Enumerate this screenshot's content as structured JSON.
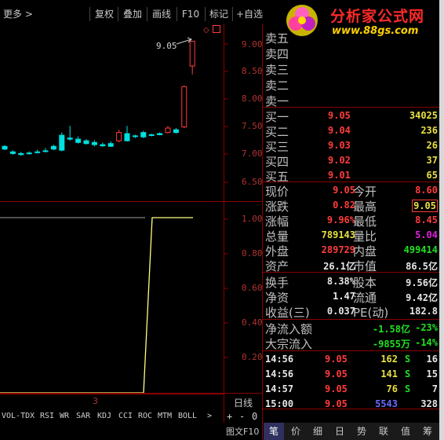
{
  "toolbar": {
    "more": "更多",
    "items": [
      "复权",
      "叠加",
      "画线",
      "F10",
      "标记",
      "+自选"
    ]
  },
  "logo": {
    "main": "分析家公式网",
    "url": "www.88gs.com"
  },
  "kline": {
    "price_labels": [
      "9.00",
      "8.50",
      "8.00",
      "7.50",
      "7.00",
      "6.50"
    ],
    "annotation": "9.05"
  },
  "indicator": {
    "labels": [
      "1.00",
      "0.80",
      "0.60",
      "0.40",
      "0.20"
    ],
    "x_marker": "3"
  },
  "period": "日线",
  "bottom_tabs": [
    "VOL-TDX",
    "RSI",
    "WR",
    "SAR",
    "KDJ",
    "CCI",
    "ROC",
    "MTM",
    "BOLL"
  ],
  "bottom_controls": [
    "+",
    "-",
    "0"
  ],
  "f10_label": "图文F10",
  "asks": [
    {
      "label": "卖五",
      "price": "",
      "vol": ""
    },
    {
      "label": "卖四",
      "price": "",
      "vol": ""
    },
    {
      "label": "卖三",
      "price": "",
      "vol": ""
    },
    {
      "label": "卖二",
      "price": "",
      "vol": ""
    },
    {
      "label": "卖一",
      "price": "",
      "vol": ""
    }
  ],
  "bids": [
    {
      "label": "买一",
      "price": "9.05",
      "vol": "34025"
    },
    {
      "label": "买二",
      "price": "9.04",
      "vol": "236"
    },
    {
      "label": "买三",
      "price": "9.03",
      "vol": "26"
    },
    {
      "label": "买四",
      "price": "9.02",
      "vol": "37"
    },
    {
      "label": "买五",
      "price": "9.01",
      "vol": "65"
    }
  ],
  "quote": [
    {
      "l1": "现价",
      "v1": "9.05",
      "l2": "今开",
      "v2": "8.60"
    },
    {
      "l1": "涨跌",
      "v1": "0.82",
      "l2": "最高",
      "v2": "9.05"
    },
    {
      "l1": "涨幅",
      "v1": "9.96%",
      "l2": "最低",
      "v2": "8.45"
    },
    {
      "l1": "总量",
      "v1": "789143",
      "l2": "量比",
      "v2": "5.04"
    },
    {
      "l1": "外盘",
      "v1": "289729",
      "l2": "内盘",
      "v2": "499414"
    },
    {
      "l1": "资产",
      "v1": "26.1亿",
      "l2": "市值",
      "v2": "86.5亿"
    }
  ],
  "fundamentals": [
    {
      "l1": "换手",
      "v1": "8.38%",
      "l2": "股本",
      "v2": "9.56亿"
    },
    {
      "l1": "净资",
      "v1": "1.47",
      "l2": "流通",
      "v2": "9.42亿"
    },
    {
      "l1": "收益(三)",
      "v1": "0.037",
      "l2": "PE(动)",
      "v2": "182.8"
    }
  ],
  "flows": [
    {
      "label": "净流入额",
      "value": "-1.58亿",
      "pct": "-23%"
    },
    {
      "label": "大宗流入",
      "value": "-9855万",
      "pct": "-14%"
    }
  ],
  "ticks": [
    {
      "time": "14:56",
      "price": "9.05",
      "vol": "162",
      "side": "S",
      "n": "16"
    },
    {
      "time": "14:56",
      "price": "9.05",
      "vol": "141",
      "side": "S",
      "n": "15"
    },
    {
      "time": "14:57",
      "price": "9.05",
      "vol": "76",
      "side": "S",
      "n": "7"
    },
    {
      "time": "15:00",
      "price": "9.05",
      "vol": "5543",
      "side": "",
      "n": "328"
    }
  ],
  "right_tabs": [
    "笔",
    "价",
    "细",
    "日",
    "势",
    "联",
    "值",
    "筹"
  ],
  "colors": {
    "grid": "#8b0000",
    "up": "#ff3c3c",
    "down": "#00e0e0",
    "line": "#ffff80"
  }
}
